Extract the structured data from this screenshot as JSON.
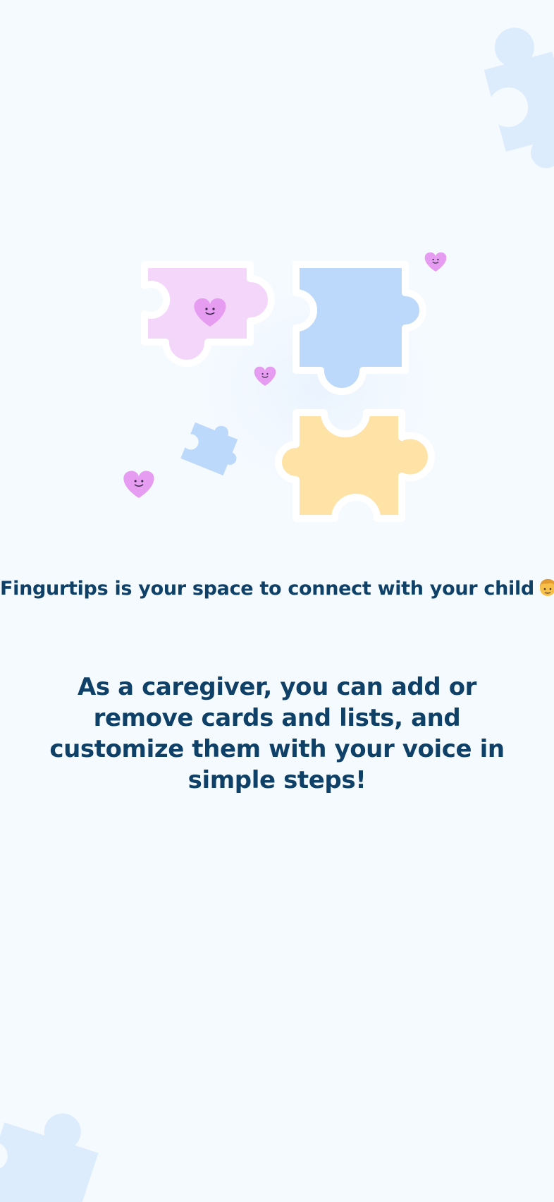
{
  "onboarding": {
    "headline": "Fingurtips is your space to connect with your child",
    "headline_emoji": "child-emoji",
    "description": "As a caregiver, you can add or remove cards and lists, and customize them with your voice in simple steps!"
  },
  "illustration": {
    "pieces": [
      "pink-puzzle-piece",
      "blue-puzzle-piece",
      "yellow-puzzle-piece",
      "small-blue-puzzle-piece"
    ],
    "hearts": [
      "heart-icon",
      "heart-icon",
      "heart-icon",
      "heart-icon"
    ]
  },
  "colors": {
    "background": "#f5faff",
    "text": "#0f4168",
    "pink_piece": "#f5d6fb",
    "blue_piece": "#bcd8fb",
    "yellow_piece": "#ffe2a6",
    "heart": "#e59cf1",
    "corner_piece": "#dcecfc"
  }
}
